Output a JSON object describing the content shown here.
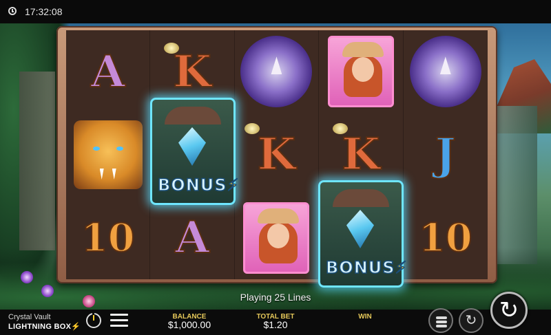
{
  "status": {
    "time": "17:32:08"
  },
  "reels": {
    "row1": [
      "A",
      "K",
      "rhino",
      "explorer",
      "rhino"
    ],
    "row2": [
      "tiger",
      "bonus",
      "K",
      "K",
      "J"
    ],
    "row3": [
      "10",
      "A",
      "explorer",
      "bonus",
      "10"
    ],
    "bonus_label": "BONUS"
  },
  "info": {
    "lines_text": "Playing 25 Lines"
  },
  "footer": {
    "game_name": "Crystal Vault",
    "brand": "LIGHTNING BOX",
    "balance_label": "BALANCE",
    "balance_value": "$1,000.00",
    "total_bet_label": "TOTAL BET",
    "total_bet_value": "$1.20",
    "win_label": "WIN",
    "win_value": ""
  },
  "icons": {
    "clock": "clock-icon",
    "sound": "sound-toggle-icon",
    "menu": "menu-icon",
    "coins": "coin-stack-icon",
    "autoplay": "autoplay-icon",
    "spin": "spin-icon"
  },
  "colors": {
    "accent_gold": "#e6c85a",
    "bonus_glow": "#6fe6ff",
    "bar_bg": "#0b0b0b"
  }
}
